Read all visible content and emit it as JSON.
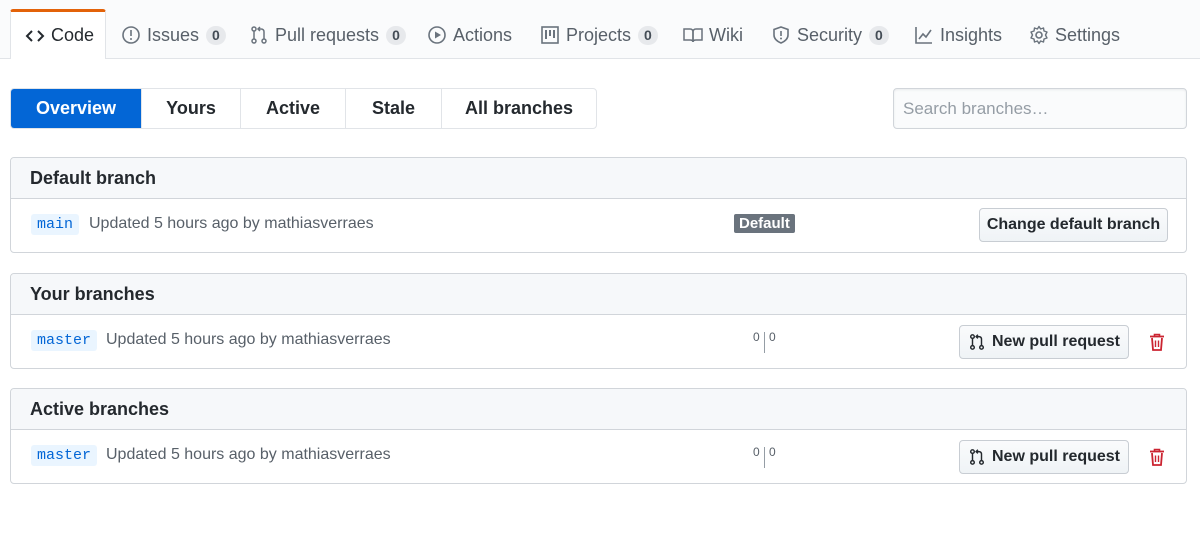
{
  "repo_nav": {
    "tabs": [
      {
        "label": "Code",
        "icon": "code-icon"
      },
      {
        "label": "Issues",
        "icon": "issue-icon",
        "count": "0"
      },
      {
        "label": "Pull requests",
        "icon": "pull-request-icon",
        "count": "0"
      },
      {
        "label": "Actions",
        "icon": "play-icon"
      },
      {
        "label": "Projects",
        "icon": "project-icon",
        "count": "0"
      },
      {
        "label": "Wiki",
        "icon": "book-icon"
      },
      {
        "label": "Security",
        "icon": "shield-icon",
        "count": "0"
      },
      {
        "label": "Insights",
        "icon": "graph-icon"
      },
      {
        "label": "Settings",
        "icon": "gear-icon"
      }
    ],
    "accent_color": "#e36209"
  },
  "subnav": {
    "items": [
      "Overview",
      "Yours",
      "Active",
      "Stale",
      "All branches"
    ],
    "selected": "Overview",
    "selected_color": "#0366d6"
  },
  "search": {
    "placeholder": "Search branches…",
    "value": ""
  },
  "default_branch": {
    "title": "Default branch",
    "branch": "main",
    "meta": "Updated 5 hours ago by mathiasverraes",
    "badge": "Default",
    "button": "Change default branch"
  },
  "your_branches": {
    "title": "Your branches",
    "branch": "master",
    "meta": "Updated 5 hours ago by mathiasverraes",
    "behind": "0",
    "ahead": "0",
    "button": "New pull request"
  },
  "active_branches": {
    "title": "Active branches",
    "branch": "master",
    "meta": "Updated 5 hours ago by mathiasverraes",
    "behind": "0",
    "ahead": "0",
    "button": "New pull request"
  },
  "colors": {
    "link": "#0366d6",
    "danger": "#cb2431",
    "muted": "#586069"
  }
}
